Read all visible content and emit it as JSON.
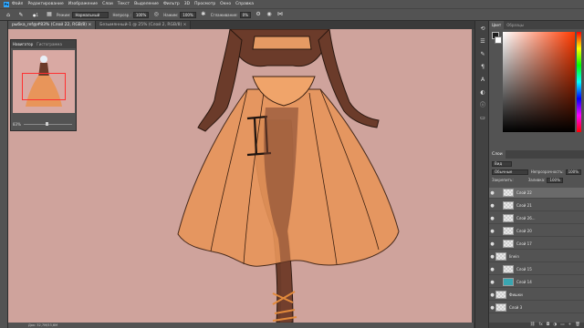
{
  "menubar": {
    "logo": "Ps",
    "items": [
      "Файл",
      "Редактирование",
      "Изображение",
      "Слои",
      "Текст",
      "Выделение",
      "Фильтр",
      "3D",
      "Просмотр",
      "Окно",
      "Справка"
    ]
  },
  "options": {
    "brush_size": "1",
    "mode_label": "Режим:",
    "mode_value": "Нормальный",
    "opacity_label": "Непрозр.:",
    "opacity_value": "100%",
    "pressure_label": "Нажим:",
    "pressure_value": "100%",
    "smoothing_label": "Сглаживание:",
    "smoothing_value": "0%"
  },
  "tabs": [
    {
      "label": "рыбка_ref@#83% (Слой 22, RGB/8) ×",
      "active": true
    },
    {
      "label": "Безымянный-1 @ 25% (Слой 2, RGB/8) ×",
      "active": false
    }
  ],
  "navigator": {
    "tab_active": "Навигатор",
    "tab_other": "Гистограмма",
    "zoom": "83%"
  },
  "statusbar": "Док: 32,7M/53,6M",
  "colors": {
    "tab_active": "Цвет",
    "tab_other": "Образцы",
    "foreground": "#1e1e1e",
    "background": "#ffffff",
    "canvas_bg": "#cfa39c",
    "skin": "#6b3b2a",
    "skirt": "#e8955a"
  },
  "layers": {
    "tab": "Слои",
    "filter": "Вид",
    "blend": "Обычные",
    "opacity_label": "Непрозрачность:",
    "opacity_value": "100%",
    "lock_label": "Закрепить:",
    "fill_label": "Заливка:",
    "fill_value": "100%",
    "items": [
      {
        "name": "Слой 22",
        "active": true,
        "indent": true,
        "thumb": "checker"
      },
      {
        "name": "Слой 21",
        "active": false,
        "indent": true,
        "thumb": "checker"
      },
      {
        "name": "Слой 26...",
        "active": false,
        "indent": true,
        "thumb": "checker"
      },
      {
        "name": "Слой 20",
        "active": false,
        "indent": true,
        "thumb": "checker"
      },
      {
        "name": "Слой 17",
        "active": false,
        "indent": true,
        "thumb": "checker"
      },
      {
        "name": "linein",
        "active": false,
        "indent": false,
        "thumb": "checker"
      },
      {
        "name": "Слой 15",
        "active": false,
        "indent": true,
        "thumb": "checker"
      },
      {
        "name": "Слой 14",
        "active": false,
        "indent": true,
        "thumb": "teal"
      },
      {
        "name": "Фишки",
        "active": false,
        "indent": false,
        "thumb": "checker"
      },
      {
        "name": "Слой 3",
        "active": false,
        "indent": false,
        "thumb": "checker"
      }
    ]
  }
}
